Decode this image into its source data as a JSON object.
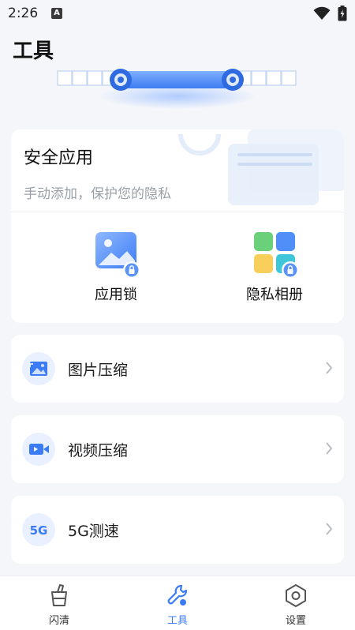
{
  "status_bar": {
    "time": "2:26",
    "app_icon": "A"
  },
  "page": {
    "title": "工具"
  },
  "security_card": {
    "title": "安全应用",
    "subtitle": "手动添加，保护您的隐私",
    "apps": [
      {
        "label": "应用锁",
        "icon": "image-lock-icon"
      },
      {
        "label": "隐私相册",
        "icon": "grid-lock-icon"
      }
    ]
  },
  "tools": [
    {
      "label": "图片压缩",
      "icon": "image-compress-icon"
    },
    {
      "label": "视频压缩",
      "icon": "video-compress-icon"
    },
    {
      "label": "5G测速",
      "icon": "5g-icon",
      "icon_text": "5G"
    }
  ],
  "tabbar": {
    "tabs": [
      {
        "label": "闪清",
        "icon": "clean-icon",
        "active": false
      },
      {
        "label": "工具",
        "icon": "wrench-icon",
        "active": true
      },
      {
        "label": "设置",
        "icon": "hexagon-settings-icon",
        "active": false
      }
    ]
  },
  "colors": {
    "accent": "#3b7cf6",
    "background": "#f4f6fa",
    "card": "#ffffff"
  }
}
